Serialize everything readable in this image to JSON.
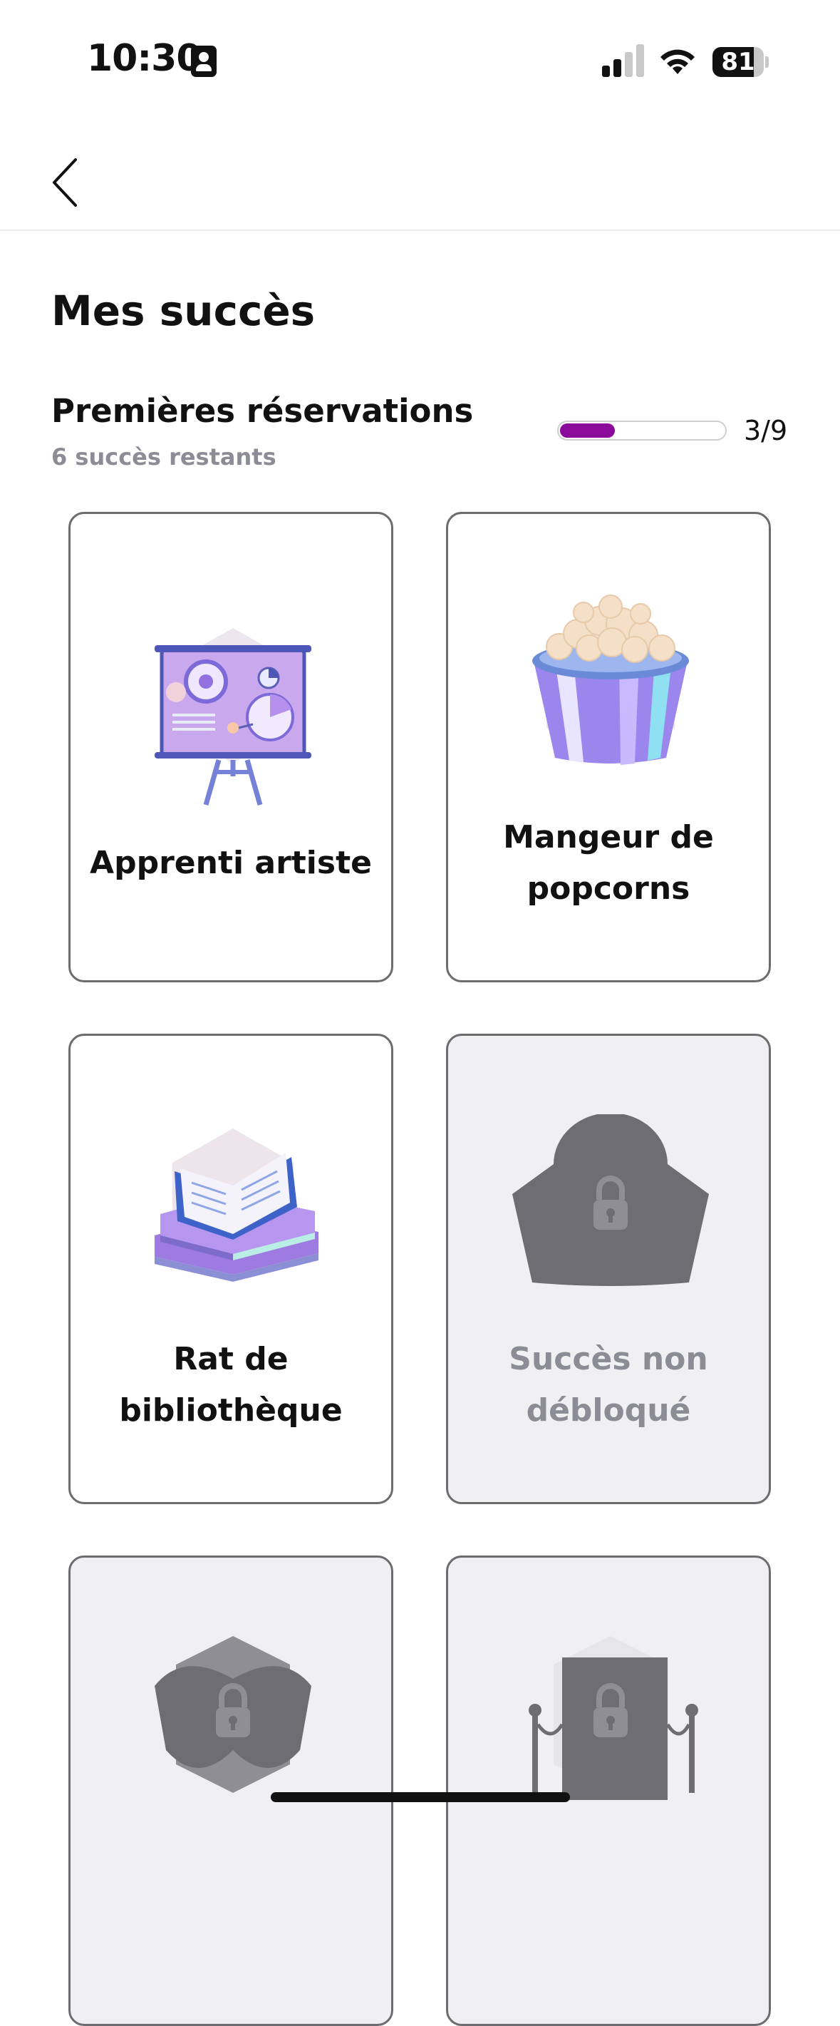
{
  "status_bar": {
    "time": "10:30",
    "battery_level": "81",
    "battery_fraction": 0.81,
    "signal_bars": 2
  },
  "nav": {
    "back_icon": "chevron-left-icon"
  },
  "page": {
    "title": "Mes succès"
  },
  "section": {
    "title": "Premières réservations",
    "subtitle": "6 succès restants",
    "progress_text": "3/9",
    "progress_fraction": 0.333,
    "accent_color": "#8a0a9a"
  },
  "achievements": [
    {
      "label": "Apprenti artiste",
      "unlocked": true,
      "icon": "presentation-board-icon"
    },
    {
      "label": "Mangeur de popcorns",
      "unlocked": true,
      "icon": "popcorn-bucket-icon"
    },
    {
      "label": "Rat de bibliothèque",
      "unlocked": true,
      "icon": "books-icon"
    },
    {
      "label": "Succès non débloqué",
      "unlocked": false,
      "icon": "locked-bowl-icon"
    },
    {
      "label": "",
      "unlocked": false,
      "icon": "locked-mask-icon"
    },
    {
      "label": "",
      "unlocked": false,
      "icon": "locked-rope-barrier-icon"
    }
  ]
}
